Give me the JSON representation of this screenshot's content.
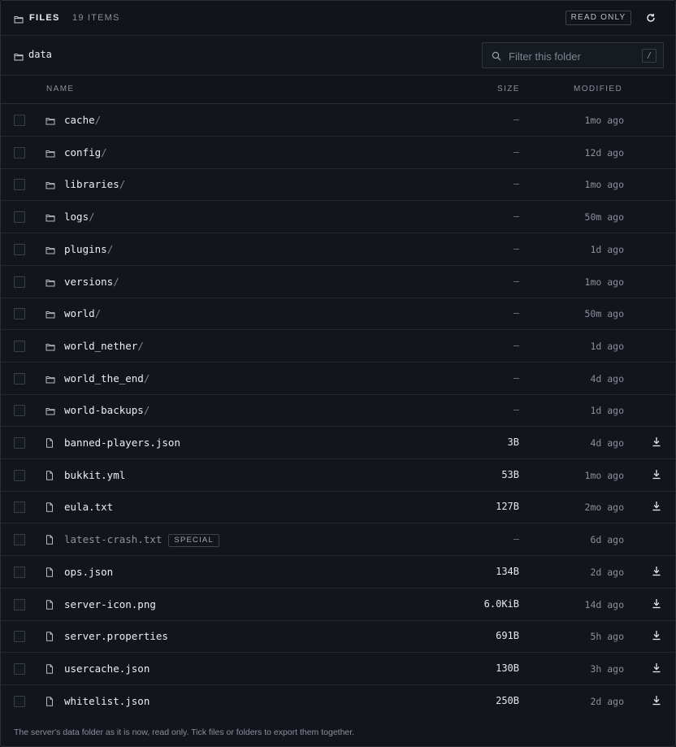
{
  "header": {
    "title": "FILES",
    "item_count": "19 ITEMS",
    "badge": "READ ONLY",
    "refresh_icon": "refresh-icon"
  },
  "path": {
    "label": "data",
    "filter_placeholder": "Filter this folder",
    "filter_value": "",
    "shortcut": "/"
  },
  "columns": {
    "name": "NAME",
    "size": "SIZE",
    "modified": "MODIFIED"
  },
  "files": [
    {
      "name": "cache",
      "suffix": "/",
      "type": "folder",
      "size": "—",
      "modified": "1mo ago",
      "download": false,
      "special": ""
    },
    {
      "name": "config",
      "suffix": "/",
      "type": "folder",
      "size": "—",
      "modified": "12d ago",
      "download": false,
      "special": ""
    },
    {
      "name": "libraries",
      "suffix": "/",
      "type": "folder",
      "size": "—",
      "modified": "1mo ago",
      "download": false,
      "special": ""
    },
    {
      "name": "logs",
      "suffix": "/",
      "type": "folder",
      "size": "—",
      "modified": "50m ago",
      "download": false,
      "special": ""
    },
    {
      "name": "plugins",
      "suffix": "/",
      "type": "folder",
      "size": "—",
      "modified": "1d ago",
      "download": false,
      "special": ""
    },
    {
      "name": "versions",
      "suffix": "/",
      "type": "folder",
      "size": "—",
      "modified": "1mo ago",
      "download": false,
      "special": ""
    },
    {
      "name": "world",
      "suffix": "/",
      "type": "folder",
      "size": "—",
      "modified": "50m ago",
      "download": false,
      "special": ""
    },
    {
      "name": "world_nether",
      "suffix": "/",
      "type": "folder",
      "size": "—",
      "modified": "1d ago",
      "download": false,
      "special": ""
    },
    {
      "name": "world_the_end",
      "suffix": "/",
      "type": "folder",
      "size": "—",
      "modified": "4d ago",
      "download": false,
      "special": ""
    },
    {
      "name": "world-backups",
      "suffix": "/",
      "type": "folder",
      "size": "—",
      "modified": "1d ago",
      "download": false,
      "special": ""
    },
    {
      "name": "banned-players.json",
      "suffix": "",
      "type": "file",
      "size": "3B",
      "modified": "4d ago",
      "download": true,
      "special": ""
    },
    {
      "name": "bukkit.yml",
      "suffix": "",
      "type": "file",
      "size": "53B",
      "modified": "1mo ago",
      "download": true,
      "special": ""
    },
    {
      "name": "eula.txt",
      "suffix": "",
      "type": "file",
      "size": "127B",
      "modified": "2mo ago",
      "download": true,
      "special": ""
    },
    {
      "name": "latest-crash.txt",
      "suffix": "",
      "type": "file",
      "size": "—",
      "modified": "6d ago",
      "download": false,
      "special": "SPECIAL"
    },
    {
      "name": "ops.json",
      "suffix": "",
      "type": "file",
      "size": "134B",
      "modified": "2d ago",
      "download": true,
      "special": ""
    },
    {
      "name": "server-icon.png",
      "suffix": "",
      "type": "file",
      "size": "6.0KiB",
      "modified": "14d ago",
      "download": true,
      "special": ""
    },
    {
      "name": "server.properties",
      "suffix": "",
      "type": "file",
      "size": "691B",
      "modified": "5h ago",
      "download": true,
      "special": ""
    },
    {
      "name": "usercache.json",
      "suffix": "",
      "type": "file",
      "size": "130B",
      "modified": "3h ago",
      "download": true,
      "special": ""
    },
    {
      "name": "whitelist.json",
      "suffix": "",
      "type": "file",
      "size": "250B",
      "modified": "2d ago",
      "download": true,
      "special": ""
    }
  ],
  "footer": {
    "note": "The server's data folder as it is now, read only. Tick files or folders to export them together."
  }
}
